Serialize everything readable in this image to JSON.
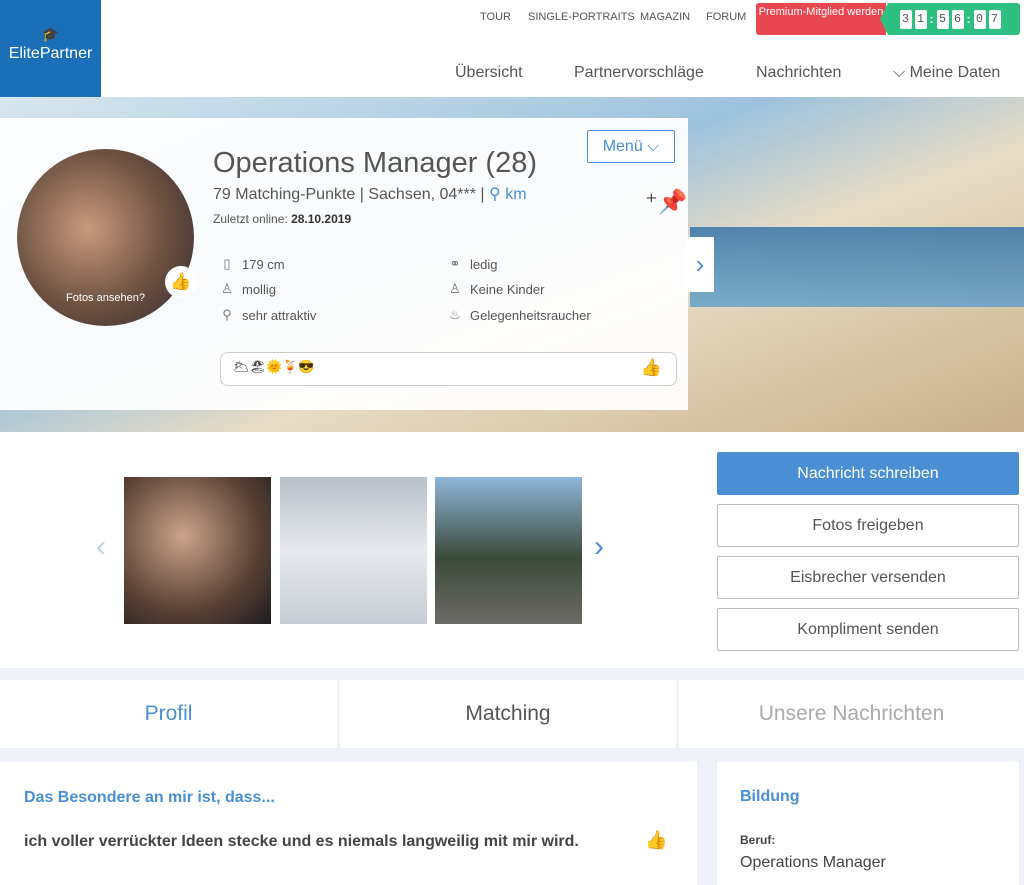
{
  "header": {
    "logo": "ElitePartner",
    "top_links": [
      "TOUR",
      "SINGLE-PORTRAITS",
      "MAGAZIN",
      "FORUM"
    ],
    "premium": "Premium-Mitglied werden",
    "timer": [
      "3",
      "1",
      ":",
      "5",
      "6",
      ":",
      "0",
      "7"
    ],
    "nav": [
      "Übersicht",
      "Partnervorschläge",
      "Nachrichten",
      "Meine Daten"
    ]
  },
  "profile": {
    "title": "Operations Manager (28)",
    "matching": "79 Matching-Punkte | Sachsen, 04*** |",
    "km": "km",
    "online_label": "Zuletzt online:",
    "online_date": "28.10.2019",
    "photos_link": "Fotos ansehen?",
    "menu": "Menü",
    "attributes": [
      {
        "icon": "ruler-icon",
        "glyph": "▯",
        "text": "179 cm"
      },
      {
        "icon": "body-icon",
        "glyph": "♙",
        "text": "mollig"
      },
      {
        "icon": "mirror-icon",
        "glyph": "⚲",
        "text": "sehr attraktiv"
      },
      {
        "icon": "rings-icon",
        "glyph": "⚭",
        "text": "ledig"
      },
      {
        "icon": "child-icon",
        "glyph": "♙",
        "text": "Keine Kinder"
      },
      {
        "icon": "cigarette-icon",
        "glyph": "♨",
        "text": "Gelegenheitsraucher"
      }
    ],
    "emojis": "🌥🏖🌞🍹😎"
  },
  "actions": [
    "Nachricht schreiben",
    "Fotos freigeben",
    "Eisbrecher versenden",
    "Kompliment senden"
  ],
  "tabs": [
    "Profil",
    "Matching",
    "Unsere Nachrichten"
  ],
  "colors": {
    "brand": "#1a6fb8",
    "accent": "#4a8fd4",
    "premium": "#e9474f",
    "timer": "#2ec081"
  },
  "special": {
    "heading": "Das Besondere an mir ist, dass...",
    "text": "ich voller verrückter Ideen stecke und es niemals langweilig mit mir wird."
  },
  "education": {
    "heading": "Bildung",
    "job_label": "Beruf:",
    "job": "Operations Manager"
  }
}
